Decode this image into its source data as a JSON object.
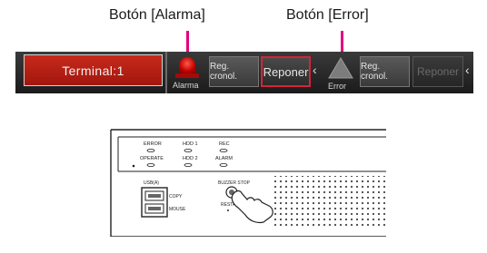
{
  "callouts": {
    "alarm_button": "Botón [Alarma]",
    "error_button": "Botón [Error]"
  },
  "status_bar": {
    "terminal_label": "Terminal:1",
    "alarm_label": "Alarma",
    "alarm_reg_button": "Reg. cronol.",
    "alarm_reset_button": "Reponer",
    "error_label": "Error",
    "error_reg_button": "Reg. cronol.",
    "error_reset_button": "Reponer",
    "chevron": "‹"
  },
  "device_panel": {
    "led_labels": [
      "ERROR",
      "HDD 1",
      "REC",
      "OPERATE",
      "HDD 2",
      "ALARM"
    ],
    "usb_label": "USB(A)",
    "copy_label": "COPY",
    "mouse_label": "MOUSE",
    "buzzer_stop_label": "BUZZER STOP",
    "restart_label": "RESTART"
  },
  "colors": {
    "callout_pointer": "#e5007e",
    "terminal_bg": "#b51f14",
    "reset_border": "#d4243a"
  }
}
